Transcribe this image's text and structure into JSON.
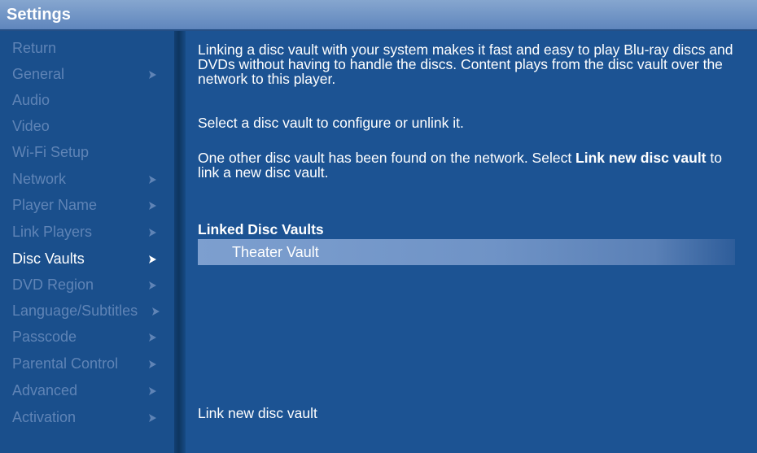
{
  "window": {
    "title": "Settings"
  },
  "sidebar": {
    "items": [
      {
        "label": "Return",
        "chevron": false,
        "active": false
      },
      {
        "label": "General",
        "chevron": true,
        "active": false
      },
      {
        "label": "Audio",
        "chevron": false,
        "active": false
      },
      {
        "label": "Video",
        "chevron": false,
        "active": false
      },
      {
        "label": "Wi-Fi Setup",
        "chevron": false,
        "active": false
      },
      {
        "label": "Network",
        "chevron": true,
        "active": false
      },
      {
        "label": "Player Name",
        "chevron": true,
        "active": false
      },
      {
        "label": "Link Players",
        "chevron": true,
        "active": false
      },
      {
        "label": "Disc Vaults",
        "chevron": true,
        "active": true
      },
      {
        "label": "DVD Region",
        "chevron": true,
        "active": false
      },
      {
        "label": "Language/Subtitles",
        "chevron": true,
        "active": false
      },
      {
        "label": "Passcode",
        "chevron": true,
        "active": false
      },
      {
        "label": "Parental Control",
        "chevron": true,
        "active": false
      },
      {
        "label": "Advanced",
        "chevron": true,
        "active": false
      },
      {
        "label": "Activation",
        "chevron": true,
        "active": false
      }
    ]
  },
  "main": {
    "intro": "Linking a disc vault with your system makes it fast and easy to play Blu-ray discs and DVDs without having to handle the discs.  Content plays from the disc vault over the network to this player.",
    "instruction": "Select a disc vault to configure or unlink it.",
    "found_prefix": "One other disc vault has been found on the network.  Select ",
    "found_bold": "Link new disc vault",
    "found_suffix": " to link a new disc vault.",
    "linked_heading": "Linked Disc Vaults",
    "linked_vaults": [
      "Theater Vault"
    ],
    "link_new_label": "Link new disc vault"
  },
  "colors": {
    "background": "#1c5393",
    "titlebar": "#6f93c6",
    "inactive_text": "#5f84b6",
    "active_text": "#ffffff",
    "highlight": "#7d9fcf"
  }
}
